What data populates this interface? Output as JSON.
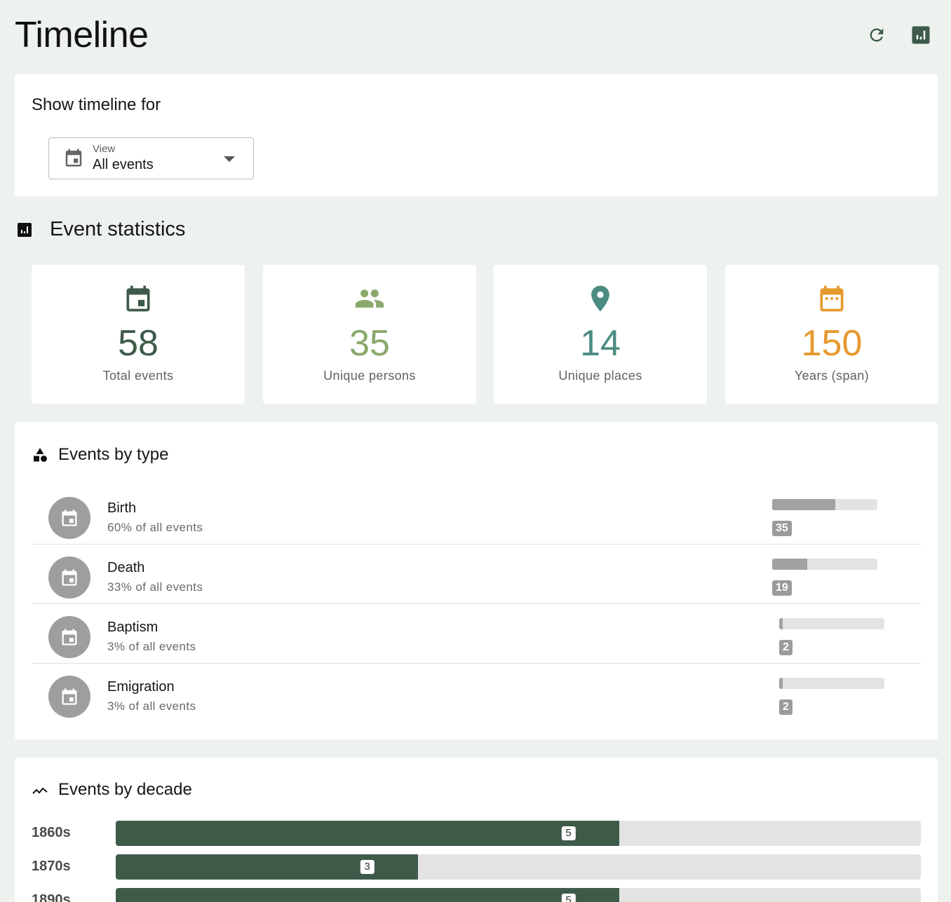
{
  "header": {
    "title": "Timeline"
  },
  "filter": {
    "label": "Show timeline for",
    "select_label": "View",
    "select_value": "All events"
  },
  "stats_section": {
    "title": "Event statistics"
  },
  "stats": [
    {
      "value": "58",
      "label": "Total events",
      "color": "#3e5b4a",
      "icon": "calendar-icon"
    },
    {
      "value": "35",
      "label": "Unique persons",
      "color": "#8aa86b",
      "icon": "people-icon"
    },
    {
      "value": "14",
      "label": "Unique places",
      "color": "#4b8b82",
      "icon": "place-icon"
    },
    {
      "value": "150",
      "label": "Years (span)",
      "color": "#e6992e",
      "icon": "calendar-month-icon"
    }
  ],
  "types": {
    "title": "Events by type",
    "rows": [
      {
        "name": "Birth",
        "pct": "60% of all events",
        "count": "35",
        "fraction": 0.6
      },
      {
        "name": "Death",
        "pct": "33% of all events",
        "count": "19",
        "fraction": 0.33
      },
      {
        "name": "Baptism",
        "pct": "3% of all events",
        "count": "2",
        "fraction": 0.03
      },
      {
        "name": "Emigration",
        "pct": "3% of all events",
        "count": "2",
        "fraction": 0.03
      }
    ]
  },
  "decades": {
    "title": "Events by decade",
    "rows": [
      {
        "label": "1860s",
        "count": "5",
        "fraction": 0.625
      },
      {
        "label": "1870s",
        "count": "3",
        "fraction": 0.375
      },
      {
        "label": "1890s",
        "count": "5",
        "fraction": 0.625
      }
    ]
  }
}
